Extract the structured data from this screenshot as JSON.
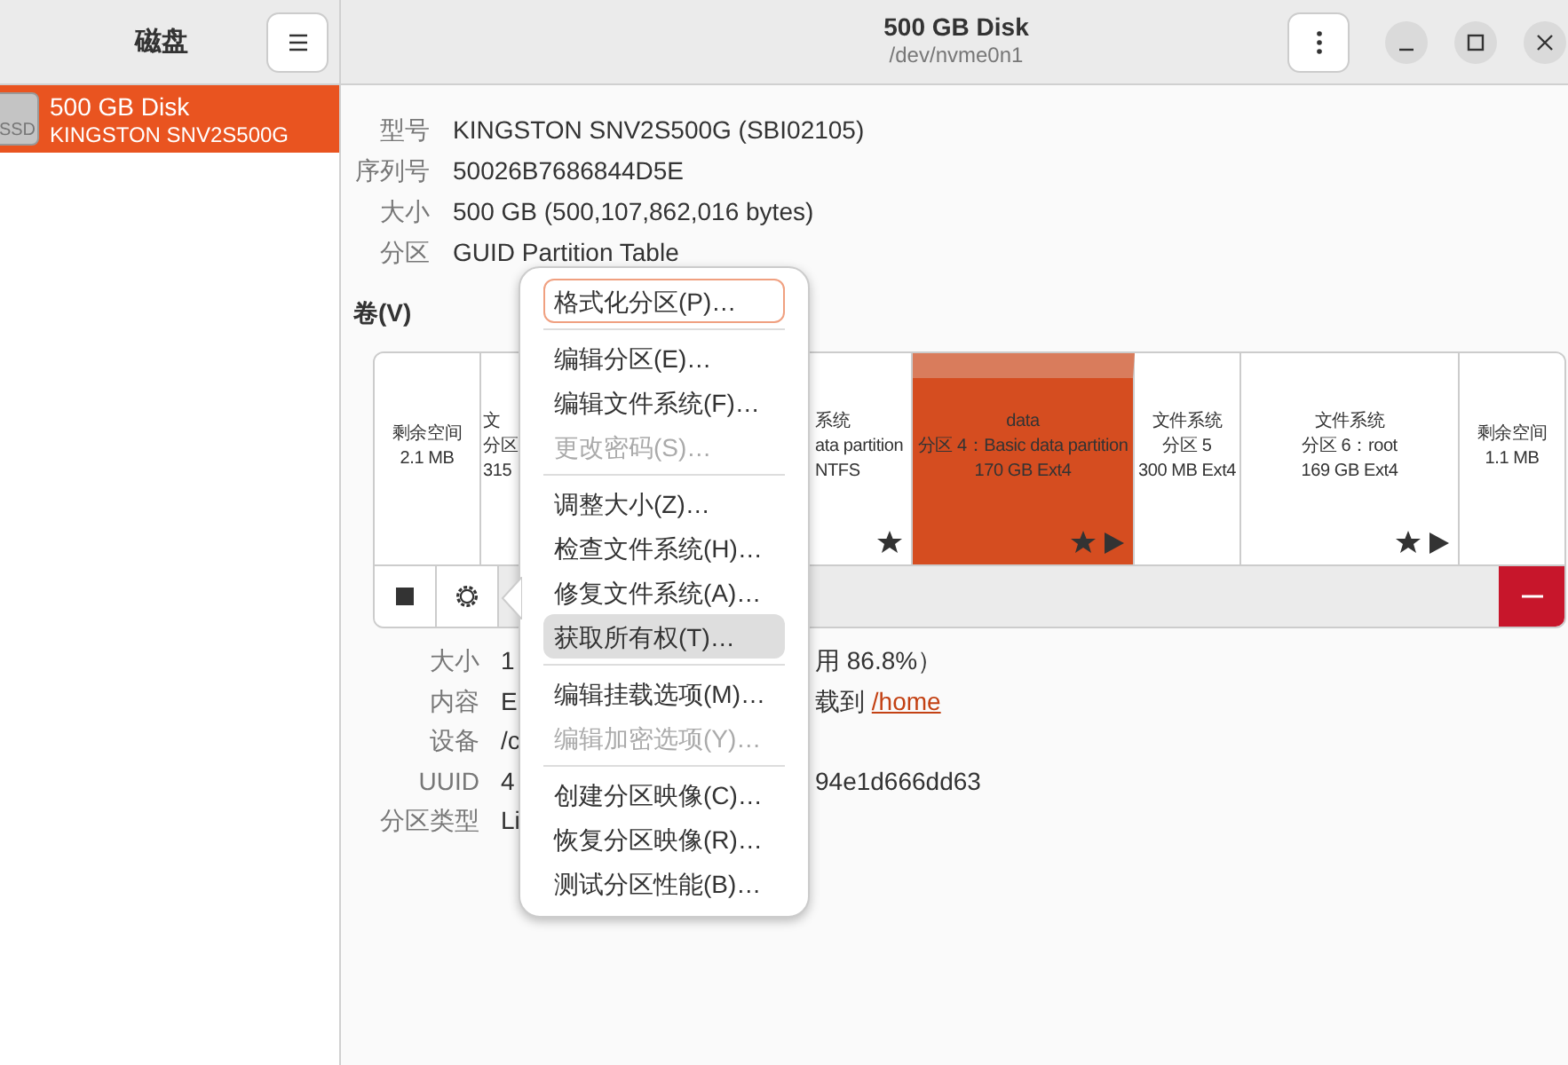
{
  "sidebar": {
    "title": "磁盘",
    "items": [
      {
        "name": "500 GB Disk",
        "model": "KINGSTON SNV2S500G",
        "icon_label": "SSD",
        "selected": true
      }
    ]
  },
  "header": {
    "title": "500 GB Disk",
    "subtitle": "/dev/nvme0n1"
  },
  "drive_info": [
    {
      "label": "型号",
      "value": "KINGSTON SNV2S500G (SBI02105)"
    },
    {
      "label": "序列号",
      "value": "50026B7686844D5E"
    },
    {
      "label": "大小",
      "value": "500 GB (500,107,862,016 bytes)"
    },
    {
      "label": "分区",
      "value": "GUID Partition Table"
    }
  ],
  "volumes": {
    "title": "卷(V)",
    "segments": [
      {
        "lines": [
          "剩余空间",
          "2.1 MB"
        ],
        "selected": false,
        "star": false,
        "play": false
      },
      {
        "lines": [
          "文",
          "分区",
          "315"
        ],
        "selected": false
      },
      {
        "lines": [
          "系统",
          "ata partition",
          "NTFS"
        ],
        "selected": false,
        "star": true,
        "play": false
      },
      {
        "lines": [
          "data",
          "分区 4：Basic data partition",
          "170 GB Ext4"
        ],
        "selected": true,
        "star": true,
        "play": true
      },
      {
        "lines": [
          "文件系统",
          "分区 5",
          "300 MB Ext4"
        ],
        "selected": false,
        "star": false,
        "play": false
      },
      {
        "lines": [
          "文件系统",
          "分区 6：root",
          "169 GB Ext4"
        ],
        "selected": false,
        "star": true,
        "play": true
      },
      {
        "lines": [
          "剩余空间",
          "1.1 MB"
        ],
        "selected": false,
        "star": false,
        "play": false
      }
    ]
  },
  "details": [
    {
      "label": "大小",
      "value_start": "1",
      "value_end": "用 86.8%）"
    },
    {
      "label": "内容",
      "value_start": "E",
      "value_end": "载到 ",
      "link": "/home"
    },
    {
      "label": "设备",
      "value_start": "/c"
    },
    {
      "label": "UUID",
      "value_start": "4",
      "value_end": "94e1d666dd63"
    },
    {
      "label": "分区类型",
      "value_start": "Li"
    }
  ],
  "menu": {
    "groups": [
      {
        "items": [
          {
            "label": "格式化分区(P)…",
            "disabled": false,
            "focused": true,
            "selected": false
          }
        ]
      },
      {
        "items": [
          {
            "label": "编辑分区(E)…",
            "disabled": false,
            "focused": false,
            "selected": false
          },
          {
            "label": "编辑文件系统(F)…",
            "disabled": false,
            "focused": false,
            "selected": false
          },
          {
            "label": "更改密码(S)…",
            "disabled": true,
            "focused": false,
            "selected": false
          }
        ]
      },
      {
        "items": [
          {
            "label": "调整大小(Z)…",
            "disabled": false,
            "focused": false,
            "selected": false
          },
          {
            "label": "检查文件系统(H)…",
            "disabled": false,
            "focused": false,
            "selected": false
          },
          {
            "label": "修复文件系统(A)…",
            "disabled": false,
            "focused": false,
            "selected": false
          },
          {
            "label": "获取所有权(T)…",
            "disabled": false,
            "focused": false,
            "selected": true
          }
        ]
      },
      {
        "items": [
          {
            "label": "编辑挂载选项(M)…",
            "disabled": false,
            "focused": false,
            "selected": false
          },
          {
            "label": "编辑加密选项(Y)…",
            "disabled": true,
            "focused": false,
            "selected": false
          }
        ]
      },
      {
        "items": [
          {
            "label": "创建分区映像(C)…",
            "disabled": false,
            "focused": false,
            "selected": false
          },
          {
            "label": "恢复分区映像(R)…",
            "disabled": false,
            "focused": false,
            "selected": false
          },
          {
            "label": "测试分区性能(B)…",
            "disabled": false,
            "focused": false,
            "selected": false
          }
        ]
      }
    ]
  }
}
